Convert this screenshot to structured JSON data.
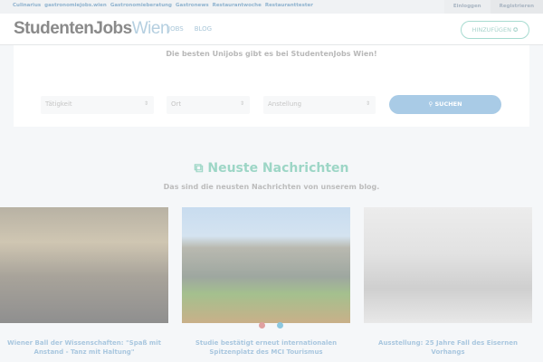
{
  "topbar": {
    "links": [
      "Culinarius",
      "gastronomiejobs.wien",
      "Gastronomieberatung",
      "Gastronews",
      "Restaurantwoche",
      "Restauranttester"
    ],
    "login": "Einloggen",
    "register": "Registrieren"
  },
  "header": {
    "logo_bold": "StudentenJobs",
    "logo_light": "Wien",
    "nav": [
      "JOBS",
      "BLOG"
    ],
    "add_button": "HINZUFÜGEN ✪"
  },
  "search": {
    "tagline": "Die besten Unijobs gibt es bei StudentenJobs Wien!",
    "activity": "Tätigkeit",
    "location": "Ort",
    "employment": "Anstellung",
    "button": "SUCHEN"
  },
  "news": {
    "title": "Neuste Nachrichten",
    "subtitle": "Das sind die neusten Nachrichten von unserem blog.",
    "items": [
      {
        "title": "Wiener Ball der Wissenschaften: \"Spaß mit Anstand - Tanz mit Haltung\""
      },
      {
        "title": "Studie bestätigt erneut internationalen Spitzenplatz des MCI Tourismus"
      },
      {
        "title": "Ausstellung: 25 Jahre Fall des Eisernen Vorhangs"
      }
    ]
  },
  "colors": {
    "accent": "#9dd6c6",
    "button": "#a9cbe6"
  }
}
